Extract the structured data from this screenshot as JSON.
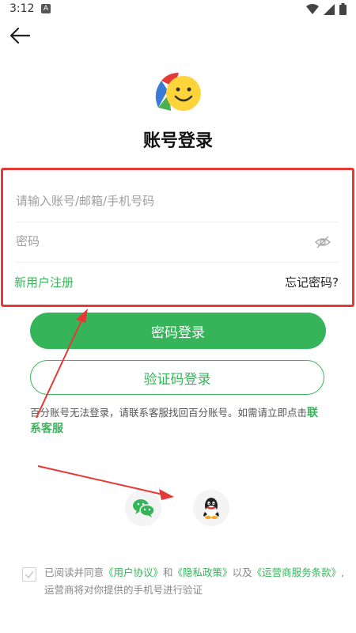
{
  "status_bar": {
    "time": "3:12",
    "notification_badge": "A"
  },
  "header": {
    "title": "账号登录"
  },
  "form": {
    "account_placeholder": "请输入账号/邮箱/手机号码",
    "password_placeholder": "密码",
    "register_label": "新用户注册",
    "forgot_label": "忘记密码?"
  },
  "buttons": {
    "password_login": "密码登录",
    "code_login": "验证码登录"
  },
  "help": {
    "text": "百分账号无法登录，请联系客服找回百分账号。如需请立即点击",
    "link": "联系客服"
  },
  "agreement": {
    "prefix": "已阅读并同意",
    "user_agreement": "《用户协议》",
    "and": "和",
    "privacy_policy": "《隐私政策》",
    "and2": "以及",
    "operator_terms": "《运营商服务条款》",
    "suffix": ",运营商将对你提供的手机号进行验证"
  },
  "colors": {
    "accent": "#36b45a",
    "annotation": "#e53935"
  },
  "icons": {
    "back": "back-arrow-icon",
    "eye": "eye-off-icon",
    "wechat": "wechat-icon",
    "qq": "qq-icon"
  }
}
